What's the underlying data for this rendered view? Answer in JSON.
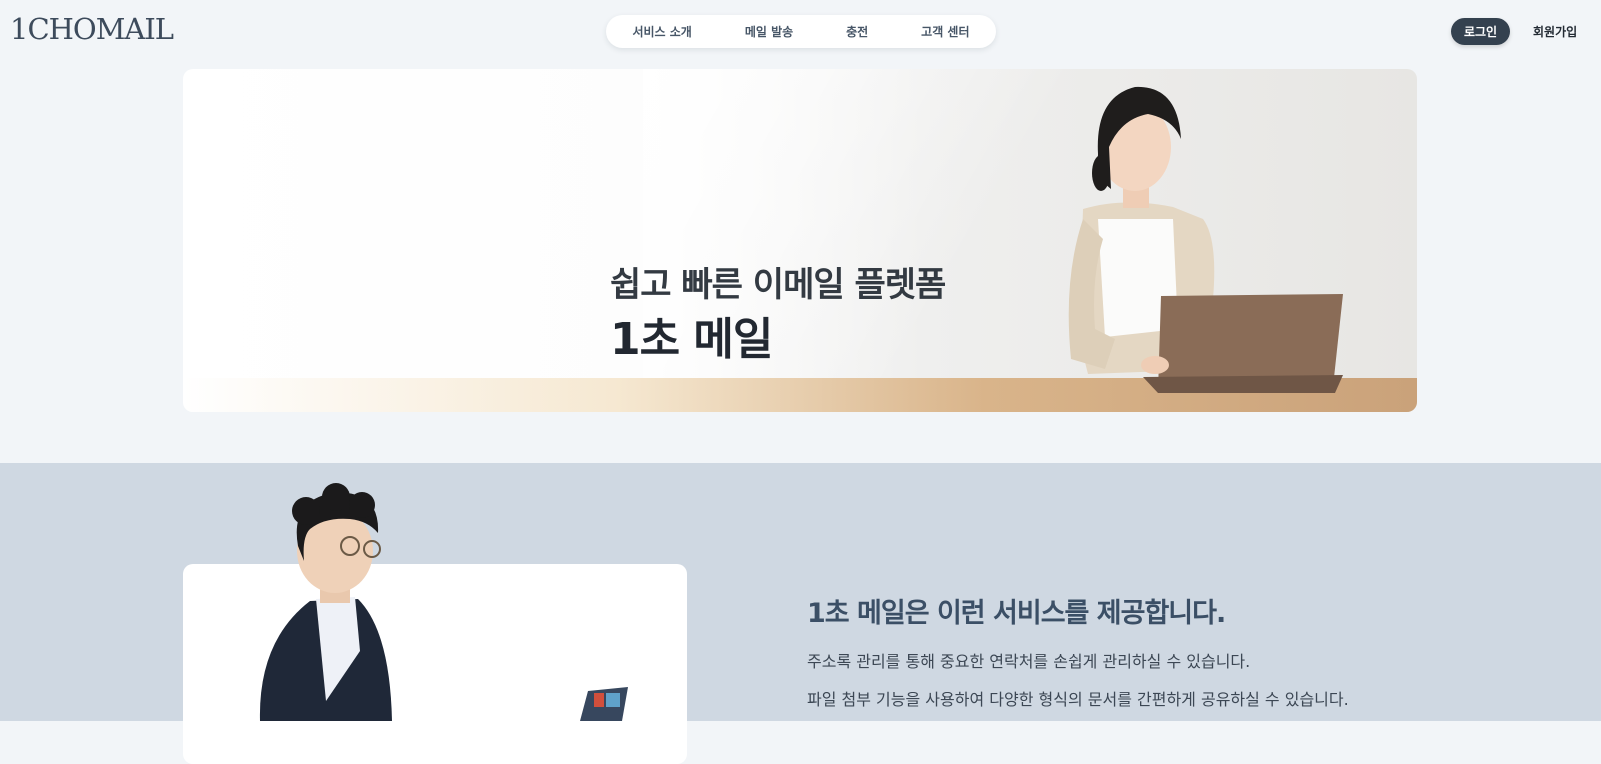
{
  "header": {
    "logo": "1CHOMAIL",
    "nav": [
      "서비스 소개",
      "메일 발송",
      "충전",
      "고객 센터"
    ],
    "login_label": "로그인",
    "signup_label": "회원가입"
  },
  "hero": {
    "subtitle": "쉽고 빠른 이메일 플렛폼",
    "title": "1초 메일"
  },
  "services": {
    "title": "1초 메일은 이런 서비스를 제공합니다.",
    "lines": [
      "주소록 관리를 통해 중요한 연락처를 손쉽게 관리하실 수 있습니다.",
      "파일 첨부 기능을 사용하여 다양한 형식의 문서를 간편하게 공유하실 수 있습니다."
    ]
  },
  "colors": {
    "page_bg": "#f2f5f8",
    "section_bg": "#cfd8e2",
    "login_bg": "#34414f",
    "heading": "#3b4f66"
  }
}
